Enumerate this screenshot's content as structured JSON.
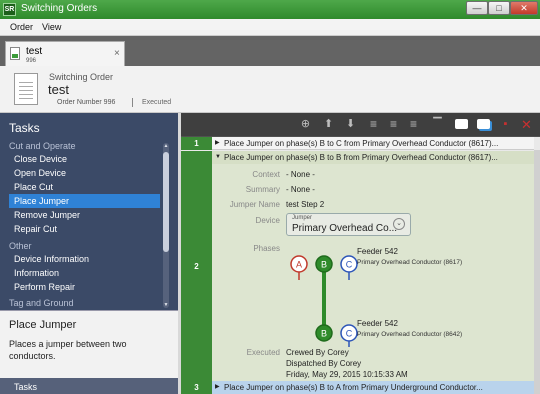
{
  "window": {
    "app_icon_text": "SR",
    "title": "Switching Orders",
    "minimize": "—",
    "maximize": "□",
    "close": "✕"
  },
  "menu": [
    "Order",
    "View"
  ],
  "doc_tab": {
    "name": "test",
    "number": "996",
    "close": "×"
  },
  "header": {
    "kind": "Switching Order",
    "name": "test",
    "order_number": "Order Number 996",
    "status": "Executed"
  },
  "left": {
    "tasks_title": "Tasks",
    "groups": [
      {
        "label": "Cut and Operate",
        "items": [
          "Close Device",
          "Open Device",
          "Place Cut",
          "Place Jumper",
          "Remove Jumper",
          "Repair Cut"
        ]
      },
      {
        "label": "Other",
        "items": [
          "Device Information",
          "Information",
          "Perform Repair"
        ]
      },
      {
        "label": "Tag and Ground",
        "items": []
      }
    ],
    "selected_item": "Place Jumper",
    "description_title": "Place Jumper",
    "description_text": "Places a jumper between two conductors.",
    "bottom_tab": "Tasks"
  },
  "toolbar": {
    "icons": [
      "expand-icon",
      "move-up-icon",
      "move-down-icon",
      "list-icon",
      "list-icon",
      "list-icon",
      "single-line-icon",
      "note-icon",
      "note-blue-icon",
      "note-red-icon",
      "delete-icon"
    ]
  },
  "steps": [
    {
      "num": "1",
      "text": "Place Jumper on phase(s) B to C from Primary Overhead Conductor (8617)..."
    },
    {
      "num": "2",
      "text": "Place Jumper on phase(s) B to B from Primary Overhead Conductor (8617)...",
      "details": {
        "context_label": "Context",
        "context_value": "- None -",
        "summary_label": "Summary",
        "summary_value": "- None -",
        "jumper_label": "Jumper Name",
        "jumper_value": "test Step 2",
        "device_label": "Device",
        "device_small": "Jumper",
        "device_value": "Primary Overhead Co...",
        "phases_label": "Phases",
        "phase_letters_top": [
          "A",
          "B",
          "C"
        ],
        "phase_letters_bottom": [
          "B",
          "C"
        ],
        "feeder_top": "Feeder 542",
        "conductor_top": "Primary Overhead Conductor (8617)",
        "feeder_bottom": "Feeder 542",
        "conductor_bottom": "Primary Overhead Conductor (8642)",
        "executed_label": "Executed",
        "executed_lines": [
          "Crewed By Corey",
          "Dispatched By Corey",
          "Friday, May 29, 2015 10:15:33 AM"
        ]
      }
    },
    {
      "num": "3",
      "text": "Place Jumper on phase(s) B to A from Primary Underground Conductor..."
    }
  ],
  "colors": {
    "green": "#3b8a36",
    "phase_red": "#c0392b",
    "phase_blue": "#2c55b8",
    "selection": "#2f82d6"
  }
}
